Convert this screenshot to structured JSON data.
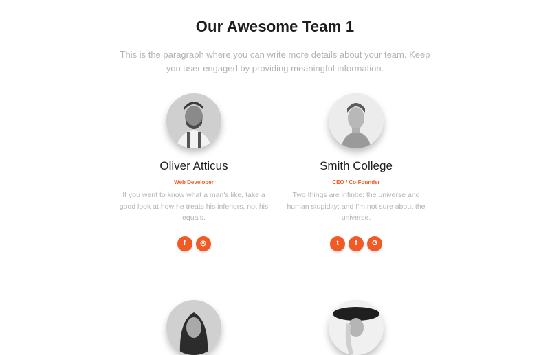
{
  "header": {
    "title": "Our Awesome Team 1",
    "paragraph": "This is the paragraph where you can write more details about your team. Keep you user engaged by providing meaningful information."
  },
  "members": [
    {
      "name": "Oliver Atticus",
      "role": "Web Developer",
      "bio": "If you want to know what a man's like, take a good look at how he treats his inferiors, not his equals.",
      "socials": [
        {
          "icon": "facebook-icon",
          "glyph": "f"
        },
        {
          "icon": "dribbble-icon",
          "glyph": "◎"
        }
      ]
    },
    {
      "name": "Smith College",
      "role": "CEO / Co-Founder",
      "bio": "Two things are infinite: the universe and human stupidity; and I'm not sure about the universe.",
      "socials": [
        {
          "icon": "twitter-icon",
          "glyph": "t"
        },
        {
          "icon": "facebook-icon",
          "glyph": "f"
        },
        {
          "icon": "google-icon",
          "glyph": "G"
        }
      ]
    },
    {
      "name": "",
      "role": "",
      "bio": "",
      "socials": []
    },
    {
      "name": "",
      "role": "",
      "bio": "",
      "socials": []
    }
  ],
  "colors": {
    "accent": "#f15a24",
    "title": "#1e1e1e",
    "muted": "#b3b3b3"
  }
}
